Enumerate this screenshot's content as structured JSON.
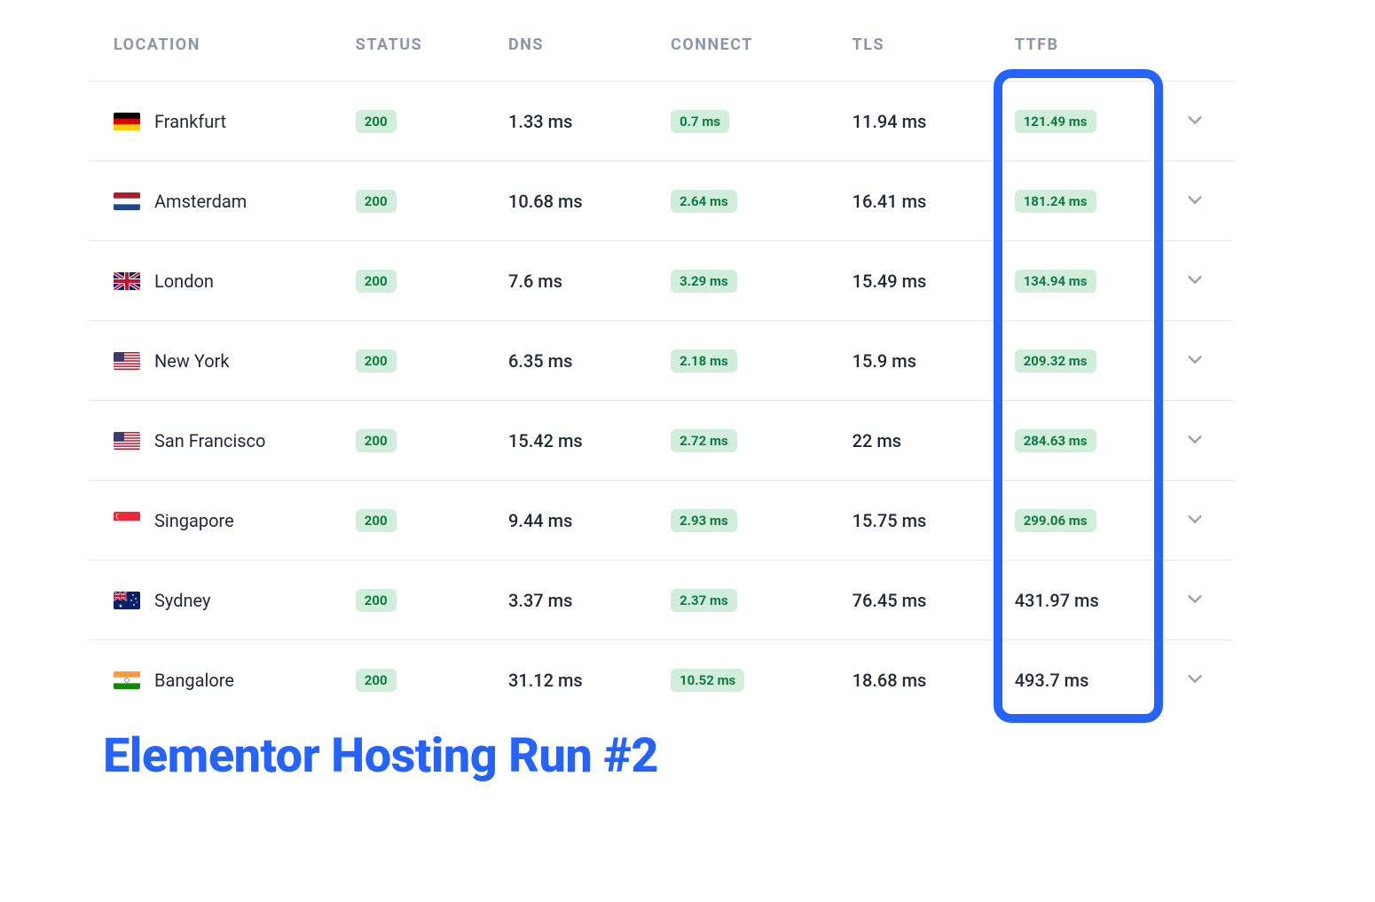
{
  "headers": {
    "location": "LOCATION",
    "status": "STATUS",
    "dns": "DNS",
    "connect": "CONNECT",
    "tls": "TLS",
    "ttfb": "TTFB"
  },
  "rows": [
    {
      "flag": "de",
      "location": "Frankfurt",
      "status": "200",
      "dns": "1.33 ms",
      "connect": "0.7 ms",
      "tls": "11.94 ms",
      "ttfb": "121.49 ms",
      "ttfb_badge": true
    },
    {
      "flag": "nl",
      "location": "Amsterdam",
      "status": "200",
      "dns": "10.68 ms",
      "connect": "2.64 ms",
      "tls": "16.41 ms",
      "ttfb": "181.24 ms",
      "ttfb_badge": true
    },
    {
      "flag": "gb",
      "location": "London",
      "status": "200",
      "dns": "7.6 ms",
      "connect": "3.29 ms",
      "tls": "15.49 ms",
      "ttfb": "134.94 ms",
      "ttfb_badge": true
    },
    {
      "flag": "us",
      "location": "New York",
      "status": "200",
      "dns": "6.35 ms",
      "connect": "2.18 ms",
      "tls": "15.9 ms",
      "ttfb": "209.32 ms",
      "ttfb_badge": true
    },
    {
      "flag": "us",
      "location": "San Francisco",
      "status": "200",
      "dns": "15.42 ms",
      "connect": "2.72 ms",
      "tls": "22 ms",
      "ttfb": "284.63 ms",
      "ttfb_badge": true
    },
    {
      "flag": "sg",
      "location": "Singapore",
      "status": "200",
      "dns": "9.44 ms",
      "connect": "2.93 ms",
      "tls": "15.75 ms",
      "ttfb": "299.06 ms",
      "ttfb_badge": true
    },
    {
      "flag": "au",
      "location": "Sydney",
      "status": "200",
      "dns": "3.37 ms",
      "connect": "2.37 ms",
      "tls": "76.45 ms",
      "ttfb": "431.97 ms",
      "ttfb_badge": false
    },
    {
      "flag": "in",
      "location": "Bangalore",
      "status": "200",
      "dns": "31.12 ms",
      "connect": "10.52 ms",
      "tls": "18.68 ms",
      "ttfb": "493.7 ms",
      "ttfb_badge": false
    }
  ],
  "caption": "Elementor Hosting Run #2",
  "highlight_column": "ttfb",
  "colors": {
    "badge_bg": "#d1eedd",
    "badge_fg": "#0f7b3e",
    "accent": "#2563ff"
  }
}
